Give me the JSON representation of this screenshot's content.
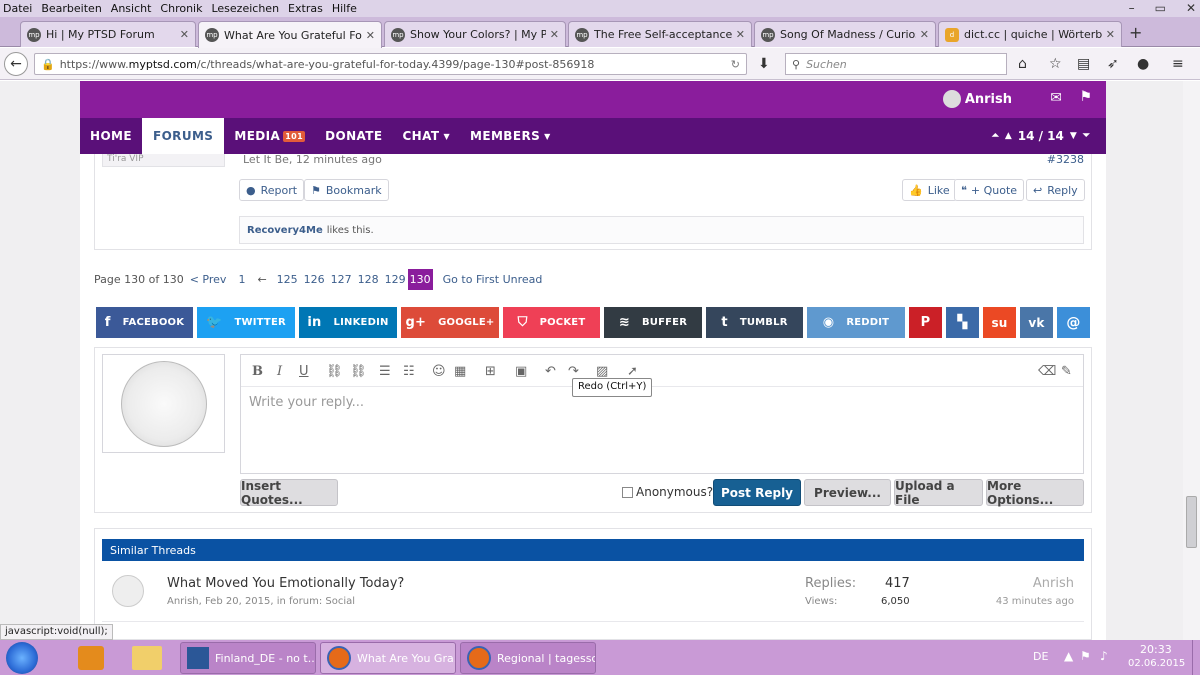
{
  "menubar": [
    "Datei",
    "Bearbeiten",
    "Ansicht",
    "Chronik",
    "Lesezeichen",
    "Extras",
    "Hilfe"
  ],
  "tabs": [
    {
      "title": "Hi | My PTSD Forum",
      "fav": "mp"
    },
    {
      "title": "What Are You Grateful For ...",
      "fav": "mp"
    },
    {
      "title": "Show Your Colors? | My PT...",
      "fav": "mp"
    },
    {
      "title": "The Free Self-acceptance P...",
      "fav": "mp"
    },
    {
      "title": "Song Of Madness / Curiosi...",
      "fav": "mp"
    },
    {
      "title": "dict.cc | quiche | Wörterbu...",
      "fav": "d"
    }
  ],
  "url": {
    "prefix": "https://www.",
    "domain": "myptsd.com",
    "path": "/c/threads/what-are-you-grateful-for-today.4399/page-130#post-856918"
  },
  "search_placeholder": "Suchen",
  "user": {
    "name": "Anrish"
  },
  "nav": {
    "home": "HOME",
    "forums": "FORUMS",
    "media": "MEDIA",
    "media_badge": "101",
    "donate": "DONATE",
    "chat": "CHAT",
    "members": "MEMBERS",
    "pager": "14 / 14"
  },
  "post": {
    "role": "Ti'ra VIP",
    "meta": "Let It Be, 12 minutes ago",
    "number": "#3238",
    "report": "Report",
    "bookmark": "Bookmark",
    "like": "Like",
    "quote": "+ Quote",
    "reply": "Reply",
    "liker": "Recovery4Me",
    "likes_suffix": "likes this."
  },
  "pagination": {
    "label": "Page 130 of 130",
    "prev": "< Prev",
    "first": "1",
    "sep": "←",
    "pages": [
      "125",
      "126",
      "127",
      "128",
      "129"
    ],
    "current": "130",
    "unread": "Go to First Unread"
  },
  "share": [
    {
      "label": "FACEBOOK",
      "color": "#3b5998",
      "icon": "f"
    },
    {
      "label": "TWITTER",
      "color": "#1da1f2",
      "icon": "🐦"
    },
    {
      "label": "LINKEDIN",
      "color": "#0077b5",
      "icon": "in"
    },
    {
      "label": "GOOGLE+",
      "color": "#dd4b39",
      "icon": "g+"
    },
    {
      "label": "POCKET",
      "color": "#ef4056",
      "icon": "⛉"
    },
    {
      "label": "BUFFER",
      "color": "#323b43",
      "icon": "≋"
    },
    {
      "label": "TUMBLR",
      "color": "#35465c",
      "icon": "t"
    },
    {
      "label": "REDDIT",
      "color": "#5f99cf",
      "icon": "◉"
    }
  ],
  "share_icons": [
    {
      "color": "#cb2027",
      "icon": "P"
    },
    {
      "color": "#3b6aa8",
      "icon": "▚"
    },
    {
      "color": "#eb4924",
      "icon": "su"
    },
    {
      "color": "#4a76a8",
      "icon": "vk"
    },
    {
      "color": "#3c8fd9",
      "icon": "@"
    }
  ],
  "editor": {
    "placeholder": "Write your reply...",
    "tooltip": "Redo (Ctrl+Y)",
    "insert_quotes": "Insert Quotes...",
    "anonymous": "Anonymous?",
    "post_reply": "Post Reply",
    "preview": "Preview...",
    "upload": "Upload a File",
    "more": "More Options..."
  },
  "similar": {
    "header": "Similar Threads",
    "threads": [
      {
        "title": "What Moved You Emotionally Today?",
        "meta": "Anrish, Feb 20, 2015, in forum: Social",
        "replies_label": "Replies:",
        "replies": "417",
        "views_label": "Views:",
        "views": "6,050",
        "last_user": "Anrish",
        "last_time": "43 minutes ago"
      }
    ]
  },
  "statusbar": "javascript:void(null);",
  "taskbar": {
    "items": [
      "Finland_DE - no t...",
      "What Are You Gra...",
      "Regional | tagessc..."
    ],
    "lang": "DE",
    "time": "20:33",
    "date": "02.06.2015"
  },
  "colors": {
    "purple": "#8a1d9c",
    "nav": "#5a1079",
    "link": "#3c5e8c",
    "accent": "#176093"
  }
}
